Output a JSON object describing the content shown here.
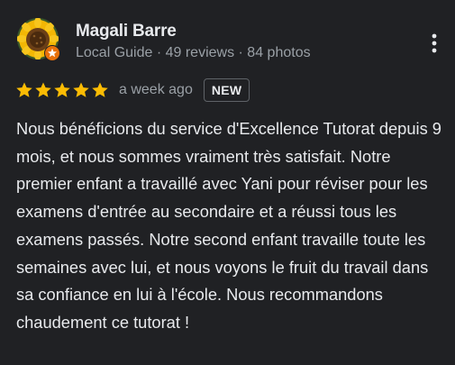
{
  "review": {
    "author_name": "Magali Barre",
    "author_meta": "Local Guide · 49 reviews · 84 photos",
    "rating": 5,
    "rating_max": 5,
    "time_ago": "a week ago",
    "badge": "NEW",
    "text": "Nous bénéficions du service d'Excellence Tutorat depuis 9 mois, et nous sommes vraiment très satisfait. Notre premier enfant a travaillé avec Yani pour réviser pour les examens d'entrée au secondaire et a réussi tous les examens passés. Notre second enfant travaille toute les semaines avec lui, et nous voyons le fruit du travail dans sa confiance en lui à l'école. Nous recommandons chaudement ce tutorat !"
  },
  "icons": {
    "avatar": "sunflower-avatar",
    "badge": "local-guide-star-badge",
    "menu": "more-vertical-icon",
    "star": "star-icon"
  },
  "colors": {
    "background": "#202124",
    "star": "#fbbc04",
    "text_primary": "#e8eaed",
    "text_secondary": "#9aa0a6",
    "guide_badge": "#e8710a"
  }
}
